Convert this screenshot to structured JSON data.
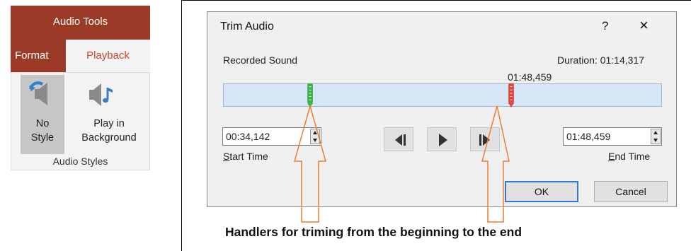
{
  "ribbon": {
    "header": "Audio Tools",
    "tabs": [
      {
        "label": "Format",
        "active": false
      },
      {
        "label": "Playback",
        "active": true
      }
    ],
    "buttons": [
      {
        "line1": "No",
        "line2": "Style",
        "icon": "speaker-undo-icon"
      },
      {
        "line1": "Play in",
        "line2": "Background",
        "icon": "speaker-note-icon"
      }
    ],
    "group_label": "Audio Styles",
    "colors": {
      "accent": "#9b3a27",
      "active_tab_text": "#c4472f"
    }
  },
  "dialog": {
    "title": "Trim Audio",
    "help_glyph": "?",
    "close_glyph": "×",
    "sound_name": "Recorded Sound",
    "duration": "Duration: 01:14,317",
    "end_marker_time": "01:48,459",
    "start_time_value": "00:34,142",
    "end_time_value": "01:48,459",
    "start_time_access_key": "S",
    "start_time_label_rest": "tart Time",
    "end_time_access_key": "E",
    "end_time_label_rest": "nd Time",
    "ok_label": "OK",
    "cancel_label": "Cancel",
    "colors": {
      "track": "#d6e6f6",
      "start_marker": "#3cb043",
      "end_marker": "#e2443a"
    }
  },
  "annotation": {
    "caption": "Handlers for triming from the beginning to the end",
    "arrow_color": "#ed7d31"
  }
}
